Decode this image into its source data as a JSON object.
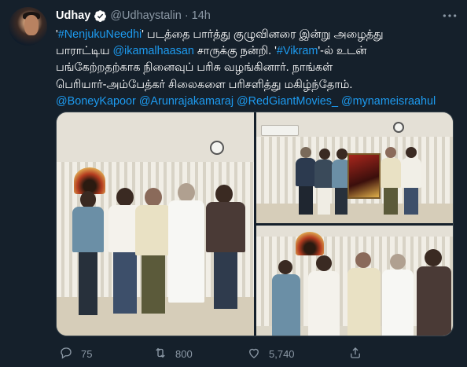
{
  "tweet": {
    "author_name": "Udhay",
    "handle": "@Udhaystalin",
    "separator": "·",
    "time": "14h",
    "text_lines": [
      [
        "'",
        "#NenjukuNeedhi",
        "' படத்தை பார்த்து குழுவினரை இன்று அழைத்து"
      ],
      [
        "பாராட்டிய ",
        "@ikamalhaasan",
        " சாருக்கு நன்றி. '",
        "#Vikram",
        "'-ல் உடன்"
      ],
      [
        "பங்கேற்றதற்காக நினைவுப் பரிசு வழங்கினார். நாங்கள்"
      ],
      [
        "பெரியார்-அம்பேத்கர் சிலைகளை பரிசளித்து மகிழ்ந்தோம்."
      ],
      [
        "@BoneyKapoor",
        " ",
        "@Arunrajakamaraj",
        " ",
        "@RedGiantMovies_",
        " ",
        "@mynameisraahul"
      ]
    ],
    "line1": {
      "q1": "'",
      "hashtag": "#NenjukuNeedhi",
      "rest": "' படத்தை பார்த்து குழுவினரை இன்று அழைத்து"
    },
    "line2": {
      "pre": "பாராட்டிய ",
      "mention": "@ikamalhaasan",
      "mid": " சாருக்கு நன்றி. '",
      "hashtag": "#Vikram",
      "post": "'-ல் உடன்"
    },
    "line3": "பங்கேற்றதற்காக நினைவுப் பரிசு வழங்கினார். நாங்கள்",
    "line4": "பெரியார்-அம்பேத்கர் சிலைகளை பரிசளித்து மகிழ்ந்தோம்.",
    "mentions": [
      "@BoneyKapoor",
      "@Arunrajakamaraj",
      "@RedGiantMovies_",
      "@mynameisraahul"
    ]
  },
  "actions": {
    "reply_count": "75",
    "retweet_count": "800",
    "like_count": "5,740"
  },
  "colors": {
    "background": "#15202b",
    "link": "#1d9bf0",
    "muted": "#8b98a5",
    "border": "#38444d"
  },
  "icons": [
    "verified-badge-icon",
    "more-icon",
    "reply-icon",
    "retweet-icon",
    "like-icon",
    "share-icon"
  ]
}
